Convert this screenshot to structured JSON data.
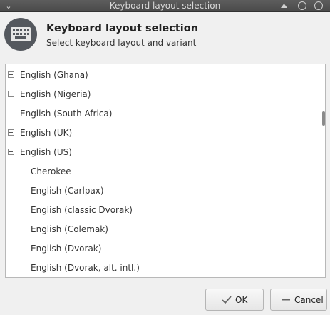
{
  "window": {
    "title": "Keyboard layout selection"
  },
  "header": {
    "title": "Keyboard layout selection",
    "subtitle": "Select keyboard layout and variant"
  },
  "layouts": [
    {
      "label": "English (Ghana)",
      "level": 0,
      "expander": "plus"
    },
    {
      "label": "English (Nigeria)",
      "level": 0,
      "expander": "plus"
    },
    {
      "label": "English (South Africa)",
      "level": 0,
      "expander": "none"
    },
    {
      "label": "English (UK)",
      "level": 0,
      "expander": "plus"
    },
    {
      "label": "English (US)",
      "level": 0,
      "expander": "minus"
    },
    {
      "label": "Cherokee",
      "level": 1,
      "expander": "none"
    },
    {
      "label": "English (Carlpax)",
      "level": 1,
      "expander": "none"
    },
    {
      "label": "English (classic Dvorak)",
      "level": 1,
      "expander": "none"
    },
    {
      "label": "English (Colemak)",
      "level": 1,
      "expander": "none"
    },
    {
      "label": "English (Dvorak)",
      "level": 1,
      "expander": "none"
    },
    {
      "label": "English (Dvorak, alt. intl.)",
      "level": 1,
      "expander": "none"
    }
  ],
  "buttons": {
    "ok_label": "OK",
    "cancel_label": "Cancel"
  },
  "icons": {
    "window_menu": "chevron-down-icon",
    "shade": "shade-up-icon",
    "minimize": "minimize-circle-icon",
    "close": "close-circle-icon",
    "app": "keyboard-icon",
    "ok": "checkmark-icon",
    "cancel": "minus-icon"
  }
}
